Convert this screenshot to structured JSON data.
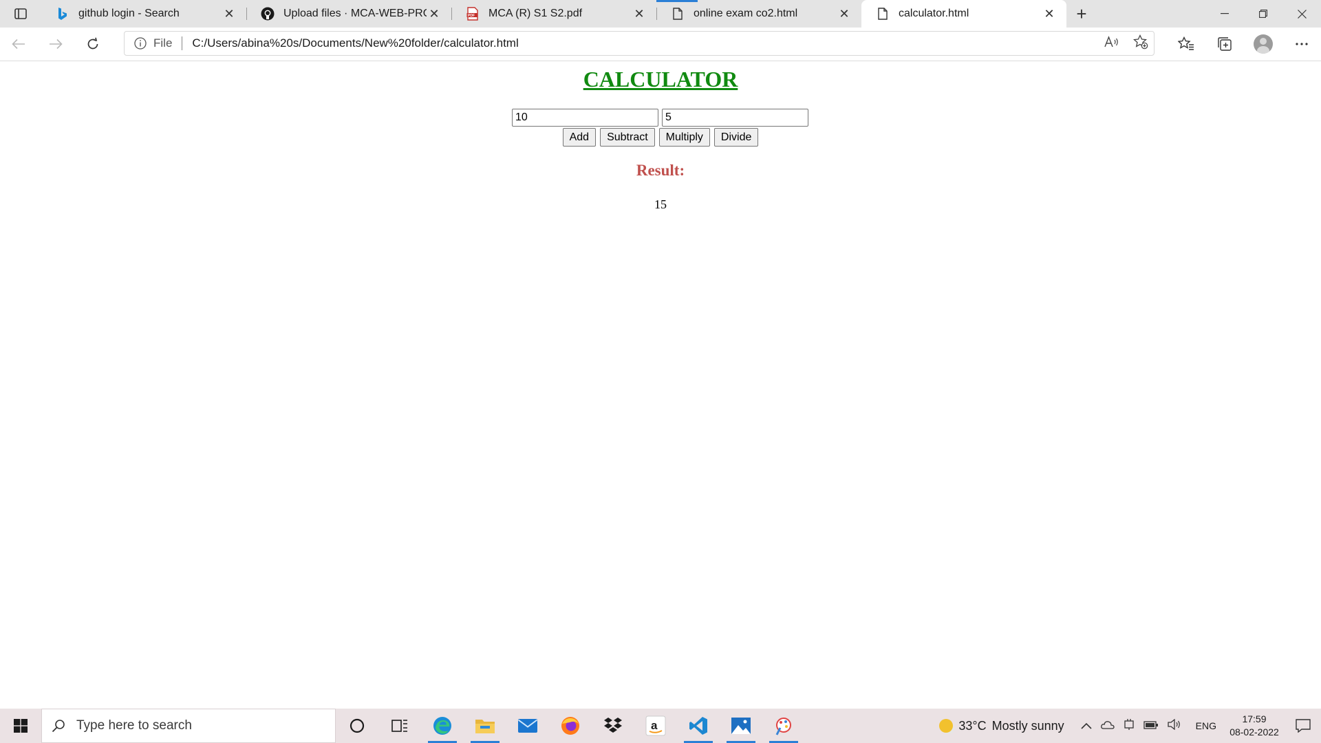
{
  "browser": {
    "tabs": [
      {
        "title": "github login - Search",
        "icon": "bing-icon",
        "active": false
      },
      {
        "title": "Upload files · MCA-WEB-PROGRAMMING",
        "icon": "github-icon",
        "active": false
      },
      {
        "title": "MCA (R) S1 S2.pdf",
        "icon": "pdf-icon",
        "active": false
      },
      {
        "title": "online exam co2.html",
        "icon": "file-icon",
        "active": false
      },
      {
        "title": "calculator.html",
        "icon": "file-icon",
        "active": true
      }
    ],
    "address": {
      "scheme_label": "File",
      "url": "C:/Users/abina%20s/Documents/New%20folder/calculator.html"
    }
  },
  "page": {
    "title": "CALCULATOR",
    "first_number": "10",
    "second_number": "5",
    "buttons": {
      "add": "Add",
      "subtract": "Subtract",
      "multiply": "Multiply",
      "divide": "Divide"
    },
    "result_label": "Result:",
    "result_value": "15",
    "colors": {
      "title": "#118a11",
      "result_label": "#c0504d"
    }
  },
  "taskbar": {
    "search_placeholder": "Type here to search",
    "apps": [
      "cortana-icon",
      "task-view-icon",
      "edge-icon",
      "file-explorer-icon",
      "mail-icon",
      "firefox-icon",
      "dropbox-icon",
      "amazon-icon",
      "vscode-icon",
      "photos-icon",
      "paint-icon"
    ],
    "weather": {
      "temperature": "33°C",
      "condition": "Mostly sunny"
    },
    "language": "ENG",
    "time": "17:59",
    "date": "08-02-2022"
  }
}
